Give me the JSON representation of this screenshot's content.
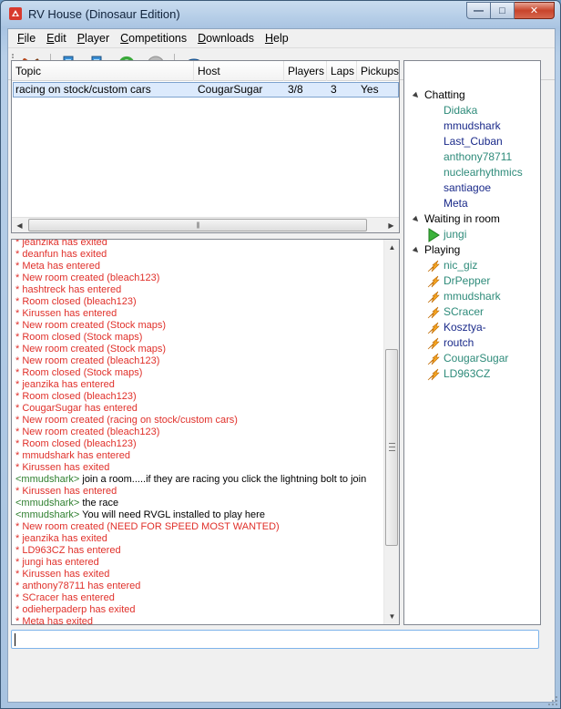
{
  "window": {
    "title": "RV House (Dinosaur Edition)"
  },
  "menu": [
    {
      "label": "File",
      "key": "F",
      "rest": "ile"
    },
    {
      "label": "Edit",
      "key": "E",
      "rest": "dit"
    },
    {
      "label": "Player",
      "key": "P",
      "rest": "layer"
    },
    {
      "label": "Competitions",
      "key": "C",
      "rest": "ompetitions"
    },
    {
      "label": "Downloads",
      "key": "D",
      "rest": "ownloads"
    },
    {
      "label": "Help",
      "key": "H",
      "rest": "elp"
    }
  ],
  "toolbar": {
    "icons": [
      "disconnect-icon",
      "host-room-icon",
      "join-room-icon",
      "refresh-icon",
      "disabled-icon",
      "settings-icon"
    ]
  },
  "rooms": {
    "columns": [
      "Topic",
      "Host",
      "Players",
      "Laps",
      "Pickups"
    ],
    "rows": [
      {
        "topic": "racing on stock/custom cars",
        "host": "CougarSugar",
        "players": "3/8",
        "laps": "3",
        "pickups": "Yes"
      }
    ]
  },
  "chat_log": [
    {
      "kind": "sys",
      "text": "* jeanzika has exited"
    },
    {
      "kind": "sys",
      "text": "* deanfun has exited"
    },
    {
      "kind": "sys",
      "text": "* Meta has entered"
    },
    {
      "kind": "sys",
      "text": "* New room created (bleach123)"
    },
    {
      "kind": "sys",
      "text": "* hashtreck has entered"
    },
    {
      "kind": "sys",
      "text": "* Room closed (bleach123)"
    },
    {
      "kind": "sys",
      "text": "* Kirussen has entered"
    },
    {
      "kind": "sys",
      "text": "* New room created (Stock maps)"
    },
    {
      "kind": "sys",
      "text": "* Room closed (Stock maps)"
    },
    {
      "kind": "sys",
      "text": "* New room created (Stock maps)"
    },
    {
      "kind": "sys",
      "text": "* New room created (bleach123)"
    },
    {
      "kind": "sys",
      "text": "* Room closed (Stock maps)"
    },
    {
      "kind": "sys",
      "text": "* jeanzika has entered"
    },
    {
      "kind": "sys",
      "text": "* Room closed (bleach123)"
    },
    {
      "kind": "sys",
      "text": "* CougarSugar has entered"
    },
    {
      "kind": "sys",
      "text": "* New room created (racing on stock/custom cars)"
    },
    {
      "kind": "sys",
      "text": "* New room created (bleach123)"
    },
    {
      "kind": "sys",
      "text": "* Room closed (bleach123)"
    },
    {
      "kind": "sys",
      "text": "* mmudshark has entered"
    },
    {
      "kind": "sys",
      "text": "* Kirussen has exited"
    },
    {
      "kind": "chat",
      "nick": "<mmudshark>",
      "text": " join a room.....if they are racing you click the lightning bolt to join"
    },
    {
      "kind": "sys",
      "text": "* Kirussen has entered"
    },
    {
      "kind": "chat",
      "nick": "<mmudshark>",
      "text": " the race"
    },
    {
      "kind": "chat",
      "nick": "<mmudshark>",
      "text": " You will need RVGL installed to play here"
    },
    {
      "kind": "sys",
      "text": "* New room created (NEED FOR SPEED MOST WANTED)"
    },
    {
      "kind": "sys",
      "text": "* jeanzika has exited"
    },
    {
      "kind": "sys",
      "text": "* LD963CZ has entered"
    },
    {
      "kind": "sys",
      "text": "* jungi has entered"
    },
    {
      "kind": "sys",
      "text": "* Kirussen has exited"
    },
    {
      "kind": "sys",
      "text": "* anthony78711 has entered"
    },
    {
      "kind": "sys",
      "text": "* SCracer has entered"
    },
    {
      "kind": "sys",
      "text": "* odieherpaderp has exited"
    },
    {
      "kind": "sys",
      "text": "* Meta has exited"
    }
  ],
  "chat_input": {
    "value": ""
  },
  "users": {
    "chatting_label": "Chatting",
    "chatting": [
      {
        "name": "Didaka",
        "color": "#2e8b7a"
      },
      {
        "name": "mmudshark",
        "color": "#1a2a8a"
      },
      {
        "name": "Last_Cuban",
        "color": "#1a2a8a"
      },
      {
        "name": "anthony78711",
        "color": "#2e8b7a"
      },
      {
        "name": "nuclearhythmics",
        "color": "#2e8b7a"
      },
      {
        "name": "santiagoe",
        "color": "#1a2a8a"
      },
      {
        "name": "Meta",
        "color": "#1a2a8a"
      }
    ],
    "waiting_label": "Waiting in room",
    "waiting": [
      {
        "name": "jungi",
        "color": "#2e8b7a"
      }
    ],
    "playing_label": "Playing",
    "playing": [
      {
        "name": "nic_giz",
        "color": "#2e8b7a"
      },
      {
        "name": "DrPepper",
        "color": "#2e8b7a"
      },
      {
        "name": "mmudshark",
        "color": "#2e8b7a"
      },
      {
        "name": "SCracer",
        "color": "#2e8b7a"
      },
      {
        "name": "Kosztya-",
        "color": "#1a2a8a"
      },
      {
        "name": "routch",
        "color": "#1a2a8a"
      },
      {
        "name": "CougarSugar",
        "color": "#2e8b7a"
      },
      {
        "name": "LD963CZ",
        "color": "#2e8b7a"
      }
    ]
  }
}
